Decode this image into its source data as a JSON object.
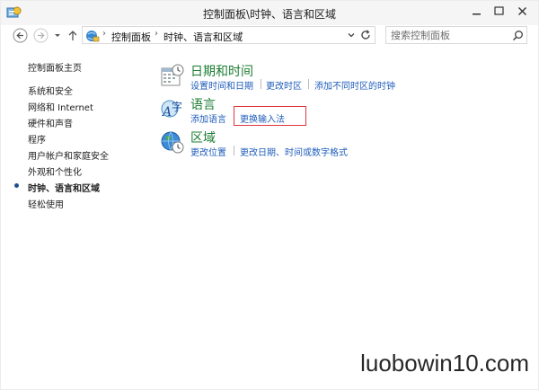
{
  "window": {
    "title": "控制面板\\时钟、语言和区域",
    "icon": "control-panel-icon"
  },
  "address_bar": {
    "breadcrumbs": [
      "控制面板",
      "时钟、语言和区域"
    ],
    "search_placeholder": "搜索控制面板"
  },
  "sidebar": {
    "items": [
      {
        "label": "控制面板主页",
        "active": false
      },
      {
        "label": "系统和安全",
        "active": false
      },
      {
        "label": "网络和 Internet",
        "active": false
      },
      {
        "label": "硬件和声音",
        "active": false
      },
      {
        "label": "程序",
        "active": false
      },
      {
        "label": "用户帐户和家庭安全",
        "active": false
      },
      {
        "label": "外观和个性化",
        "active": false
      },
      {
        "label": "时钟、语言和区域",
        "active": true
      },
      {
        "label": "轻松使用",
        "active": false
      }
    ]
  },
  "categories": {
    "datetime": {
      "title": "日期和时间",
      "icon": "calendar-clock-icon",
      "links": [
        "设置时间和日期",
        "更改时区",
        "添加不同时区的时钟"
      ]
    },
    "language": {
      "title": "语言",
      "icon": "language-icon",
      "links": [
        "添加语言",
        "更换输入法"
      ]
    },
    "region": {
      "title": "区域",
      "icon": "globe-clock-icon",
      "links": [
        "更改位置",
        "更改日期、时间或数字格式"
      ]
    }
  },
  "colors": {
    "category_title": "#1b7d31",
    "link": "#1f5dbb",
    "highlight_border": "#e0363f"
  },
  "watermark": "luobowin10.com"
}
